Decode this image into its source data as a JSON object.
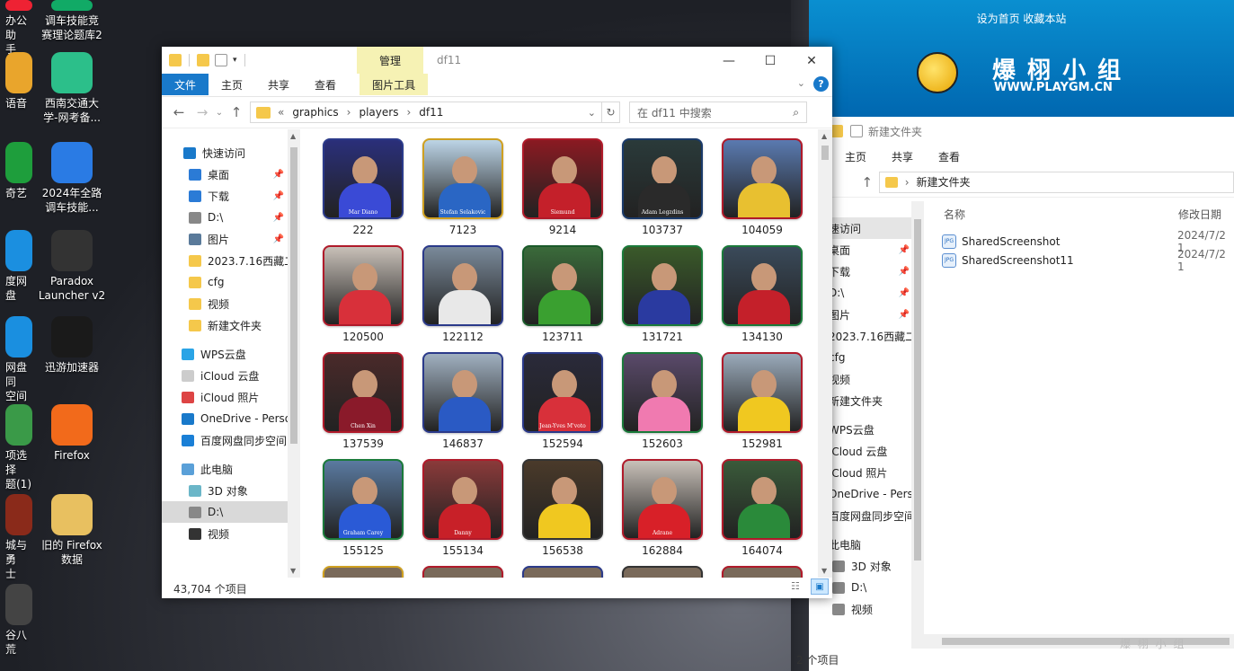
{
  "desktop_icons": [
    {
      "label": "办公助\n手"
    },
    {
      "label": "调车技能竞\n赛理论题库2"
    },
    {
      "label": "语音"
    },
    {
      "label": "西南交通大\n学-网考备..."
    },
    {
      "label": "奇艺"
    },
    {
      "label": "2024年全路\n调车技能..."
    },
    {
      "label": "度网盘"
    },
    {
      "label": "Paradox\nLauncher v2"
    },
    {
      "label": "网盘同\n空间"
    },
    {
      "label": "迅游加速器"
    },
    {
      "label": "项选择\n题(1)"
    },
    {
      "label": "Firefox"
    },
    {
      "label": "城与勇\n士"
    },
    {
      "label": "旧的 Firefox\n数据"
    },
    {
      "label": "谷八荒"
    }
  ],
  "website": {
    "links": "设为首页  收藏本站",
    "logo_cn": "爆 栩 小 组",
    "logo_url": "WWW.PLAYGM.CN",
    "watermark": "爆 栩 小 组"
  },
  "main_window": {
    "title": "df11",
    "ctx_tab": "管理",
    "tabs": [
      "文件",
      "主页",
      "共享",
      "查看",
      "图片工具"
    ],
    "breadcrumb": [
      "«",
      "graphics",
      "›",
      "players",
      "›",
      "df11"
    ],
    "search_placeholder": "在 df11 中搜索",
    "nav": [
      {
        "label": "快速访问",
        "pin": false
      },
      {
        "label": "桌面",
        "pin": true
      },
      {
        "label": "下载",
        "pin": true
      },
      {
        "label": "D:\\",
        "pin": true
      },
      {
        "label": "图片",
        "pin": true
      },
      {
        "label": "2023.7.16西藏二",
        "pin": false
      },
      {
        "label": "cfg",
        "pin": false
      },
      {
        "label": "视频",
        "pin": false
      },
      {
        "label": "新建文件夹",
        "pin": false
      },
      {
        "label": "WPS云盘",
        "pin": false
      },
      {
        "label": "iCloud 云盘",
        "pin": false
      },
      {
        "label": "iCloud 照片",
        "pin": false
      },
      {
        "label": "OneDrive - Perso",
        "pin": false
      },
      {
        "label": "百度网盘同步空间",
        "pin": false
      },
      {
        "label": "此电脑",
        "pin": false
      },
      {
        "label": "3D 对象",
        "pin": false
      },
      {
        "label": "D:\\",
        "pin": false
      },
      {
        "label": "视频",
        "pin": false
      }
    ],
    "files": [
      {
        "name": "222",
        "player": "Mar Diano"
      },
      {
        "name": "7123",
        "player": "Stefan Selakovic"
      },
      {
        "name": "9214",
        "player": "Siemund"
      },
      {
        "name": "103737",
        "player": "Adam Legzdins"
      },
      {
        "name": "104059",
        "player": ""
      },
      {
        "name": "120500",
        "player": ""
      },
      {
        "name": "122112",
        "player": ""
      },
      {
        "name": "123711",
        "player": ""
      },
      {
        "name": "131721",
        "player": ""
      },
      {
        "name": "134130",
        "player": ""
      },
      {
        "name": "137539",
        "player": "Chen Xin"
      },
      {
        "name": "146837",
        "player": ""
      },
      {
        "name": "152594",
        "player": "Jean-Yves M'voto"
      },
      {
        "name": "152603",
        "player": ""
      },
      {
        "name": "152981",
        "player": ""
      },
      {
        "name": "155125",
        "player": "Graham Carey"
      },
      {
        "name": "155134",
        "player": "Danny"
      },
      {
        "name": "156538",
        "player": ""
      },
      {
        "name": "162884",
        "player": "Adrane"
      },
      {
        "name": "164074",
        "player": ""
      }
    ],
    "status": "43,704 个项目"
  },
  "second_window": {
    "title": "新建文件夹",
    "tabs": [
      "主页",
      "共享",
      "查看"
    ],
    "breadcrumb": "新建文件夹",
    "col_name": "名称",
    "col_date": "修改日期",
    "nav": [
      "快速访问",
      "桌面",
      "下载",
      "D:\\",
      "图片",
      "2023.7.16西藏二",
      "cfg",
      "视频",
      "新建文件夹",
      "WPS云盘",
      "iCloud 云盘",
      "iCloud 照片",
      "OneDrive - Perso",
      "百度网盘同步空间",
      "此电脑",
      "3D 对象",
      "D:\\",
      "视频"
    ],
    "files": [
      {
        "name": "SharedScreenshot",
        "date": "2024/7/2 1"
      },
      {
        "name": "SharedScreenshot11",
        "date": "2024/7/2 1"
      }
    ],
    "status": "2 个项目"
  },
  "colors": {
    "accent": "#1979ca",
    "ctx_tab": "#f6f2b4",
    "selected": "#cce8ff"
  }
}
